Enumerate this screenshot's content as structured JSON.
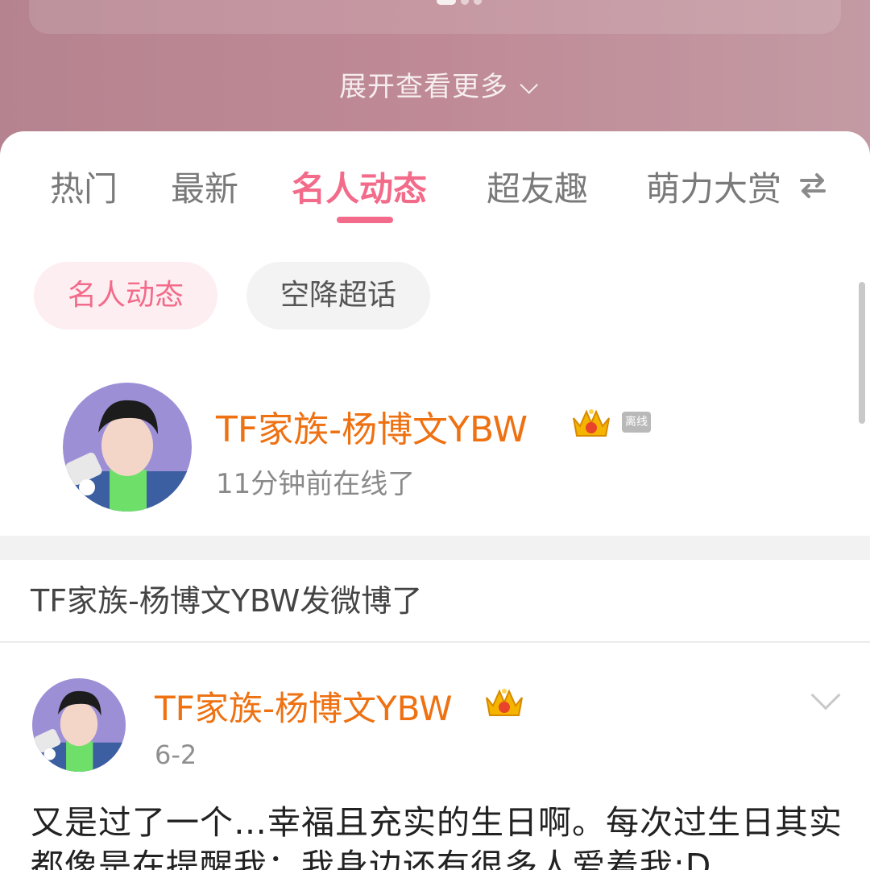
{
  "hero": {
    "expand_label": "展开查看更多"
  },
  "tabs": [
    {
      "label": "热门"
    },
    {
      "label": "最新"
    },
    {
      "label": "名人动态",
      "active": true
    },
    {
      "label": "超友趣"
    },
    {
      "label": "萌力大赏"
    }
  ],
  "chips": [
    {
      "label": "名人动态",
      "active": true
    },
    {
      "label": "空降超话"
    }
  ],
  "profile": {
    "name": "TF家族-杨博文YBW",
    "status_badge": "离线",
    "last_seen": "11分钟前在线了"
  },
  "section": {
    "title": "TF家族-杨博文YBW发微博了"
  },
  "post": {
    "author": "TF家族-杨博文YBW",
    "date": "6-2",
    "text": "又是过了一个…幸福且充实的生日啊。每次过生日其实都像是在提醒我：我身边还有很多人爱着我:D"
  },
  "colors": {
    "accent_pink": "#f36b8a",
    "name_orange": "#ee7112",
    "hero_bg": "#bf8a96"
  },
  "icons": {
    "crown": "crown-badge-icon",
    "swap": "swap-arrows-icon",
    "expand": "chevron-down-icon",
    "post_menu": "chevron-down-icon"
  }
}
